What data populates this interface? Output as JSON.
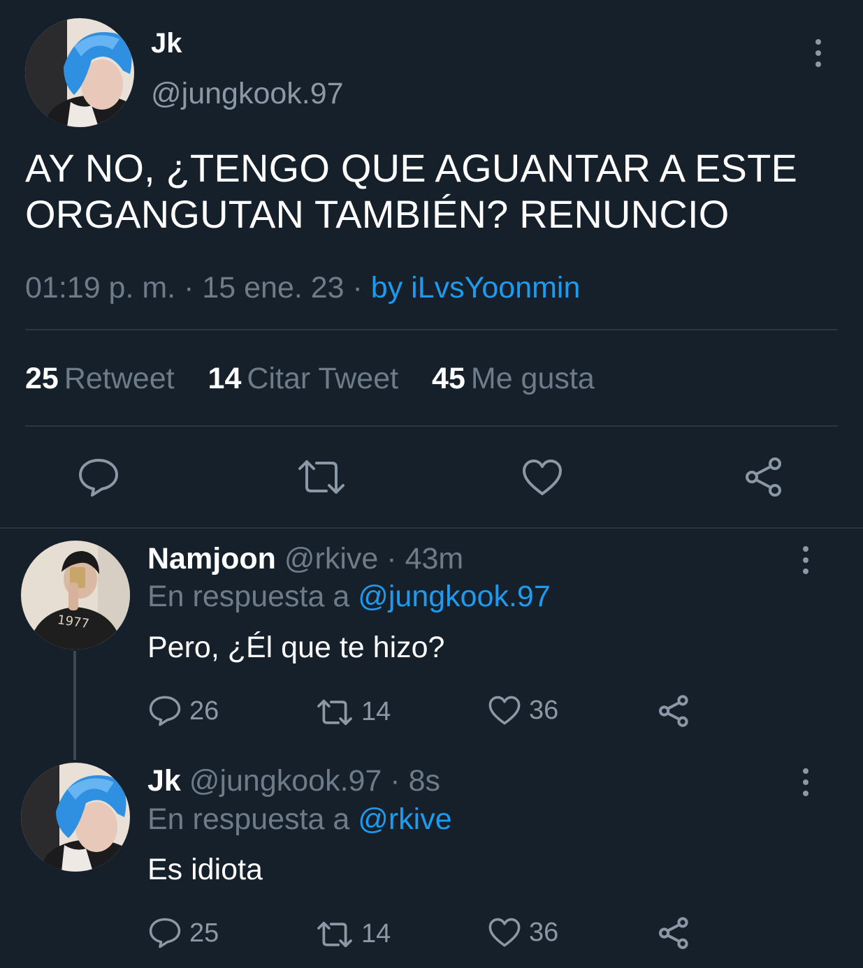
{
  "main_tweet": {
    "author_name": "Jk",
    "author_handle": "@jungkook.97",
    "text_line1": "AY NO, ¿TENGO QUE AGUANTAR A ESTE",
    "text_line2": "ORGANGUTAN TAMBIÉN? RENUNCIO",
    "timestamp": "01:19 p. m. · 15 ene. 23 · ",
    "via": "by iLvsYoonmin",
    "stats": [
      {
        "count": "25",
        "label": "Retweet"
      },
      {
        "count": "14",
        "label": "Citar Tweet"
      },
      {
        "count": "45",
        "label": "Me gusta"
      }
    ],
    "actions": [
      "reply-icon",
      "retweet-icon",
      "like-icon",
      "share-icon"
    ]
  },
  "replies": [
    {
      "name": "Namjoon",
      "handle": "@rkive",
      "time": " · 43m",
      "reply_prefix": "En respuesta a ",
      "reply_to": "@jungkook.97",
      "text": "Pero, ¿Él que te hizo?",
      "reply_count": "26",
      "retweet_count": "14",
      "like_count": "36"
    },
    {
      "name": "Jk",
      "handle": "@jungkook.97",
      "time": " · 8s",
      "reply_prefix": "En respuesta a ",
      "reply_to": "@rkive",
      "text": "Es idiota",
      "reply_count": "25",
      "retweet_count": "14",
      "like_count": "36"
    }
  ],
  "colors": {
    "background": "#16202b",
    "text_primary": "#ffffff",
    "text_secondary": "#6e7c89",
    "accent": "#1d9bf0",
    "divider": "#2c3640"
  }
}
